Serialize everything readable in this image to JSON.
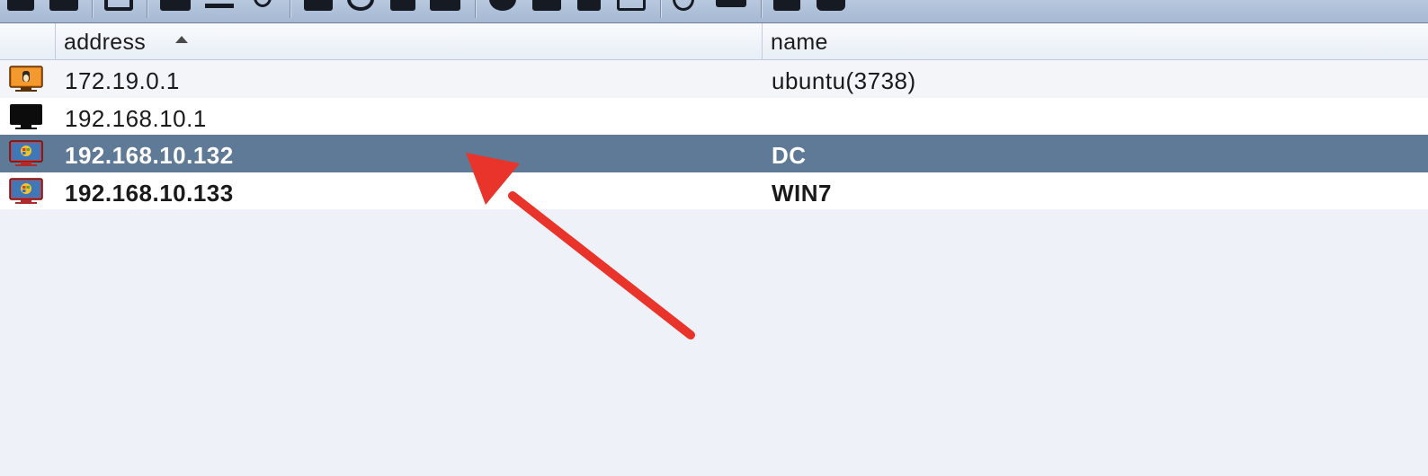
{
  "toolbar": {
    "buttons": [
      {
        "icon": "toolbar-tool-icon"
      },
      {
        "icon": "toolbar-tool-icon"
      },
      {
        "icon": "toolbar-tool-icon"
      },
      {
        "icon": "toolbar-tool-icon"
      },
      {
        "icon": "toolbar-tool-icon"
      },
      {
        "icon": "toolbar-tool-icon"
      },
      {
        "icon": "toolbar-tool-icon"
      },
      {
        "icon": "toolbar-tool-icon"
      },
      {
        "icon": "toolbar-tool-icon"
      },
      {
        "icon": "toolbar-tool-icon"
      },
      {
        "icon": "toolbar-tool-icon"
      },
      {
        "icon": "toolbar-tool-icon"
      },
      {
        "icon": "toolbar-tool-icon"
      },
      {
        "icon": "toolbar-tool-icon"
      },
      {
        "icon": "toolbar-tool-icon"
      },
      {
        "icon": "toolbar-tool-icon"
      },
      {
        "icon": "toolbar-tool-icon"
      },
      {
        "icon": "toolbar-tool-icon"
      }
    ]
  },
  "table": {
    "columns": {
      "address": "address",
      "name": "name"
    },
    "sort": {
      "column": "address",
      "direction": "ascending"
    },
    "rows": [
      {
        "icon": "linux-host-icon",
        "address": "172.19.0.1",
        "name": "ubuntu(3738)",
        "selected": false,
        "bold": false
      },
      {
        "icon": "unknown-host-icon",
        "address": "192.168.10.1",
        "name": "",
        "selected": false,
        "bold": false
      },
      {
        "icon": "windows-host-compromised-icon",
        "address": "192.168.10.132",
        "name": "DC",
        "selected": true,
        "bold": true
      },
      {
        "icon": "windows-host-compromised-icon",
        "address": "192.168.10.133",
        "name": "WIN7",
        "selected": false,
        "bold": true
      }
    ]
  },
  "colors": {
    "toolbar_bg": "#a9bcd5",
    "header_bg": "#eef2f8",
    "selected_row": "#5f7a97",
    "empty_area": "#eef1f8",
    "annotation_arrow": "#e8342a"
  }
}
